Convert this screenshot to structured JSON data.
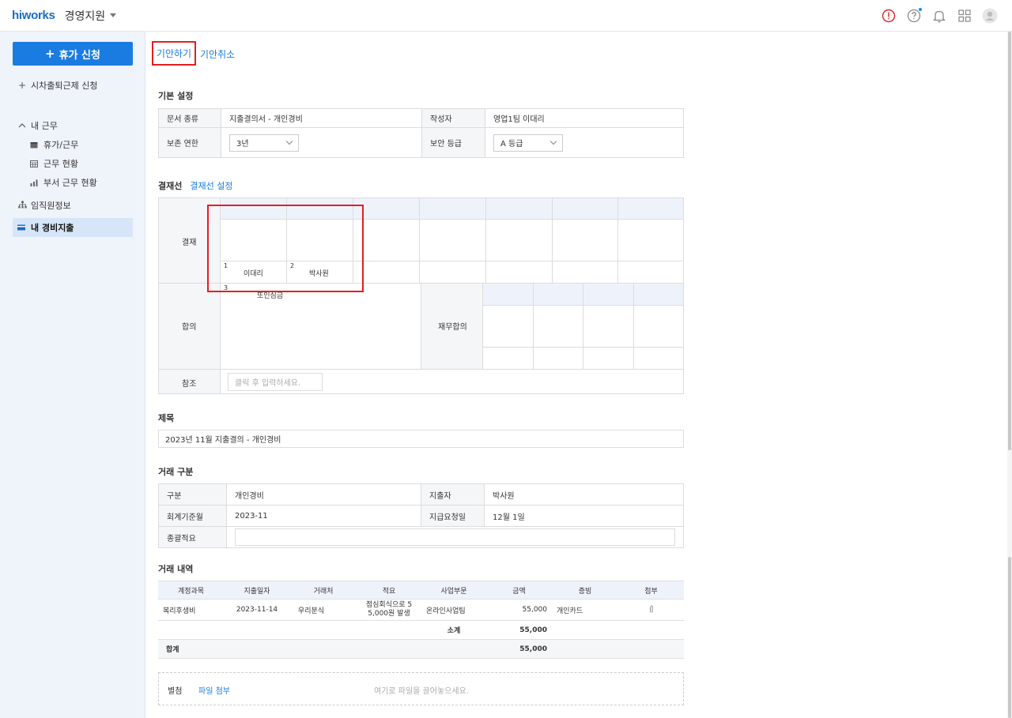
{
  "header": {
    "logo": "hiworks",
    "app_name": "경영지원",
    "icons": [
      "alert-icon",
      "help-icon",
      "bell-icon",
      "apps-grid-icon",
      "avatar-icon"
    ]
  },
  "sidebar": {
    "leave_button": "휴가 신청",
    "flex_work": "시차출퇴근제 신청",
    "my_work": "내 근무",
    "sub_items": [
      "휴가/근무",
      "근무 현황",
      "부서 근무 현황"
    ],
    "employee_info": "임직원정보",
    "my_expense": "내 경비지출"
  },
  "tabs": {
    "draft": "기안하기",
    "cancel": "기안취소"
  },
  "basic": {
    "title": "기본 설정",
    "doc_type_label": "문서 종류",
    "doc_type_value": "지출결의서 - 개인경비",
    "author_label": "작성자",
    "author_value": "영업1팀 이대리",
    "retention_label": "보존 연한",
    "retention_value": "3년",
    "security_label": "보안 등급",
    "security_value": "A 등급"
  },
  "approval": {
    "title": "결재선",
    "setting_link": "결재선 설정",
    "approve_label": "결재",
    "approvers": [
      {
        "num": "1",
        "name": "이대리"
      },
      {
        "num": "2",
        "name": "박사원"
      }
    ],
    "agree_label": "합의",
    "agree_num": "3",
    "agree_name": "또인심금",
    "finance_label": "재무합의",
    "ref_label": "참조",
    "ref_placeholder": "클릭 후 입력하세요."
  },
  "subject": {
    "title": "제목",
    "value": "2023년 11월 지출결의 - 개인경비"
  },
  "transaction": {
    "title": "거래 구분",
    "type_label": "구분",
    "type_value": "개인경비",
    "payer_label": "지출자",
    "payer_value": "박사원",
    "period_label": "회계기준월",
    "period_value": "2023-11",
    "pay_date_label": "지급요청일",
    "pay_date_value": "12월 1일",
    "summary_label": "종괄적요"
  },
  "details": {
    "title": "거래 내역",
    "columns": [
      "계정과목",
      "지출일자",
      "거래처",
      "적요",
      "사업부문",
      "금액",
      "증빙",
      "첨부"
    ],
    "row": {
      "account": "복리후생비",
      "date": "2023-11-14",
      "vendor": "우리분식",
      "memo_line1": "점심회식으로 5",
      "memo_line2": "5,000원 발생",
      "division": "온라인사업팀",
      "amount": "55,000",
      "proof": "개인카드"
    },
    "subtotal_label": "소계",
    "subtotal_value": "55,000",
    "total_label": "합계",
    "total_value": "55,000"
  },
  "attachment": {
    "label": "별첨",
    "link": "파일 첨부",
    "hint": "여기로 파일을 끌어놓으세요."
  }
}
